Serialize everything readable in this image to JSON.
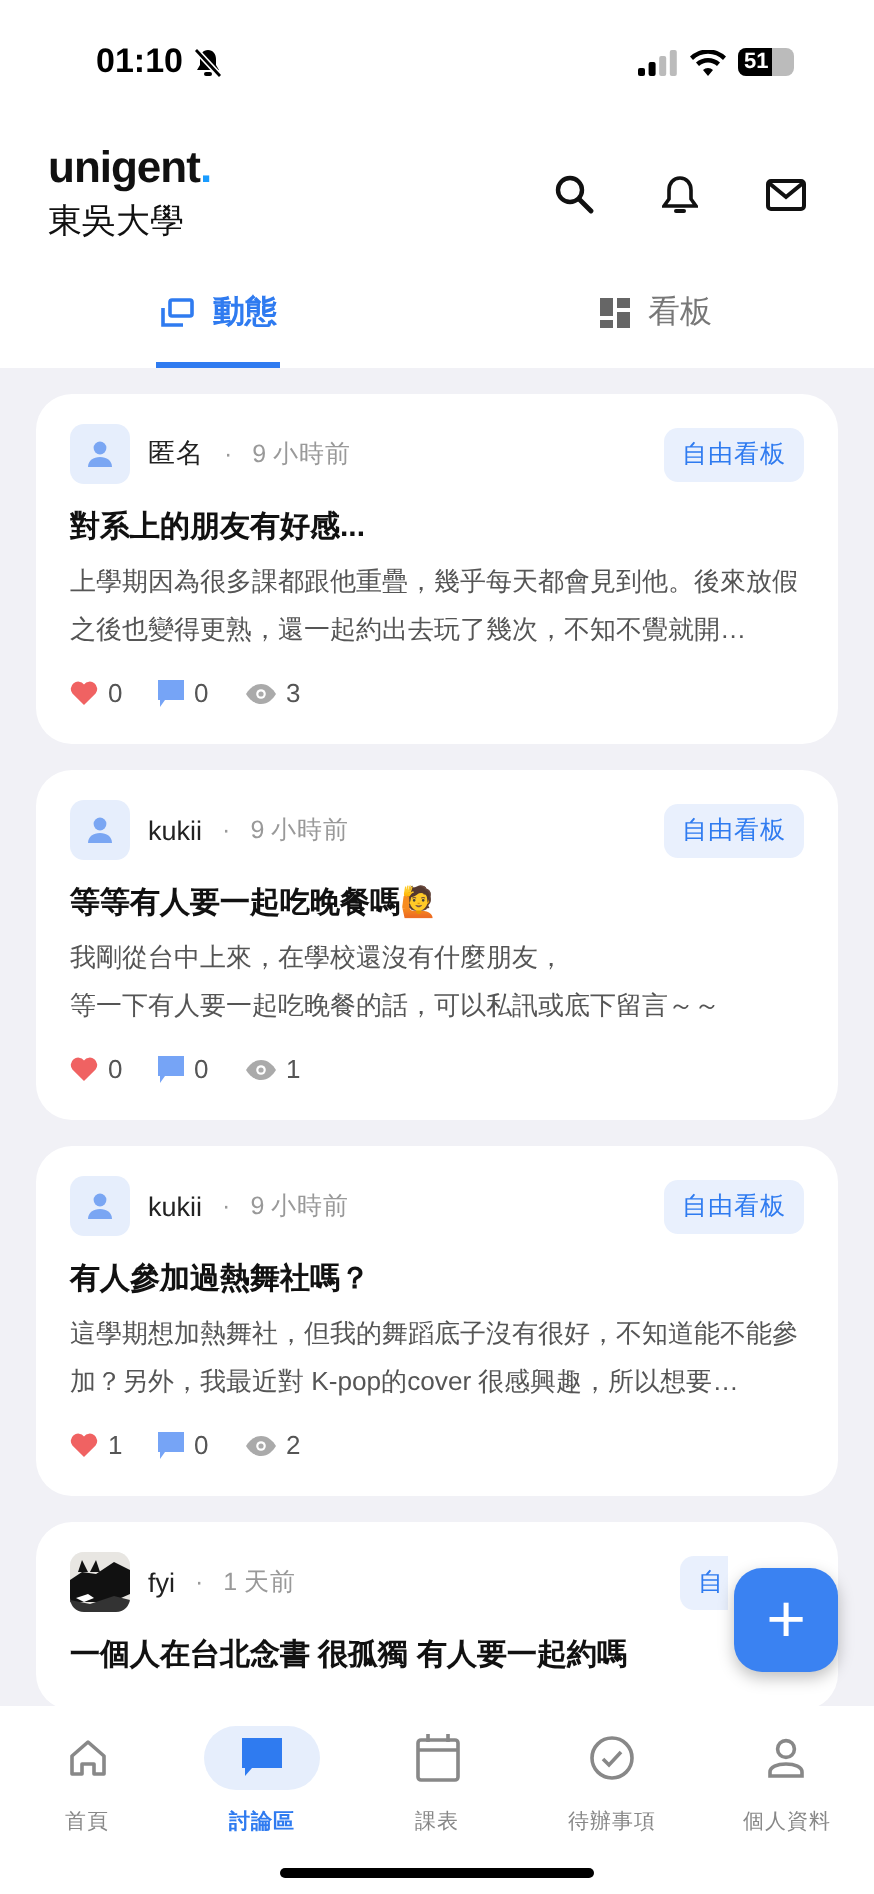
{
  "status_bar": {
    "time": "01:10",
    "battery": "51"
  },
  "header": {
    "logo": "unigent",
    "logo_dot": ".",
    "school": "東吳大學"
  },
  "tabs": [
    {
      "label": "動態",
      "selected": true
    },
    {
      "label": "看板",
      "selected": false
    }
  ],
  "posts": [
    {
      "avatar": {
        "kind": "default"
      },
      "author": "匿名",
      "separator": "·",
      "time": "9 小時前",
      "board": "自由看板",
      "title": "對系上的朋友有好感...",
      "excerpt": [
        "上學期因為很多課都跟他重疊，幾乎每天都會見到他。後來放假之後也變得更熟，還一起約出去玩了幾次，不知不覺就開…"
      ],
      "likes": "0",
      "comments": "0",
      "views": "3"
    },
    {
      "avatar": {
        "kind": "default"
      },
      "author": "kukii",
      "separator": "·",
      "time": "9 小時前",
      "board": "自由看板",
      "title": "等等有人要一起吃晚餐嗎🙋",
      "excerpt": [
        "我剛從台中上來，在學校還沒有什麼朋友，",
        "等一下有人要一起吃晚餐的話，可以私訊或底下留言～～"
      ],
      "likes": "0",
      "comments": "0",
      "views": "1"
    },
    {
      "avatar": {
        "kind": "default"
      },
      "author": "kukii",
      "separator": "·",
      "time": "9 小時前",
      "board": "自由看板",
      "title": "有人參加過熱舞社嗎？",
      "excerpt": [
        "這學期想加熱舞社，但我的舞蹈底子沒有很好，不知道能不能參加？另外，我最近對 K-pop的cover 很感興趣，所以想要…"
      ],
      "likes": "1",
      "comments": "0",
      "views": "2"
    },
    {
      "author": "fyi",
      "separator": "·",
      "time": "1 天前",
      "board": "自",
      "title": "一個人在台北念書 很孤獨 有人要一起約嗎"
    }
  ],
  "fab": {
    "label": "+"
  },
  "bottom_nav": [
    {
      "label": "首頁",
      "selected": false
    },
    {
      "label": "討論區",
      "selected": true
    },
    {
      "label": "課表",
      "selected": false
    },
    {
      "label": "待辦事項",
      "selected": false
    },
    {
      "label": "個人資料",
      "selected": false
    }
  ]
}
